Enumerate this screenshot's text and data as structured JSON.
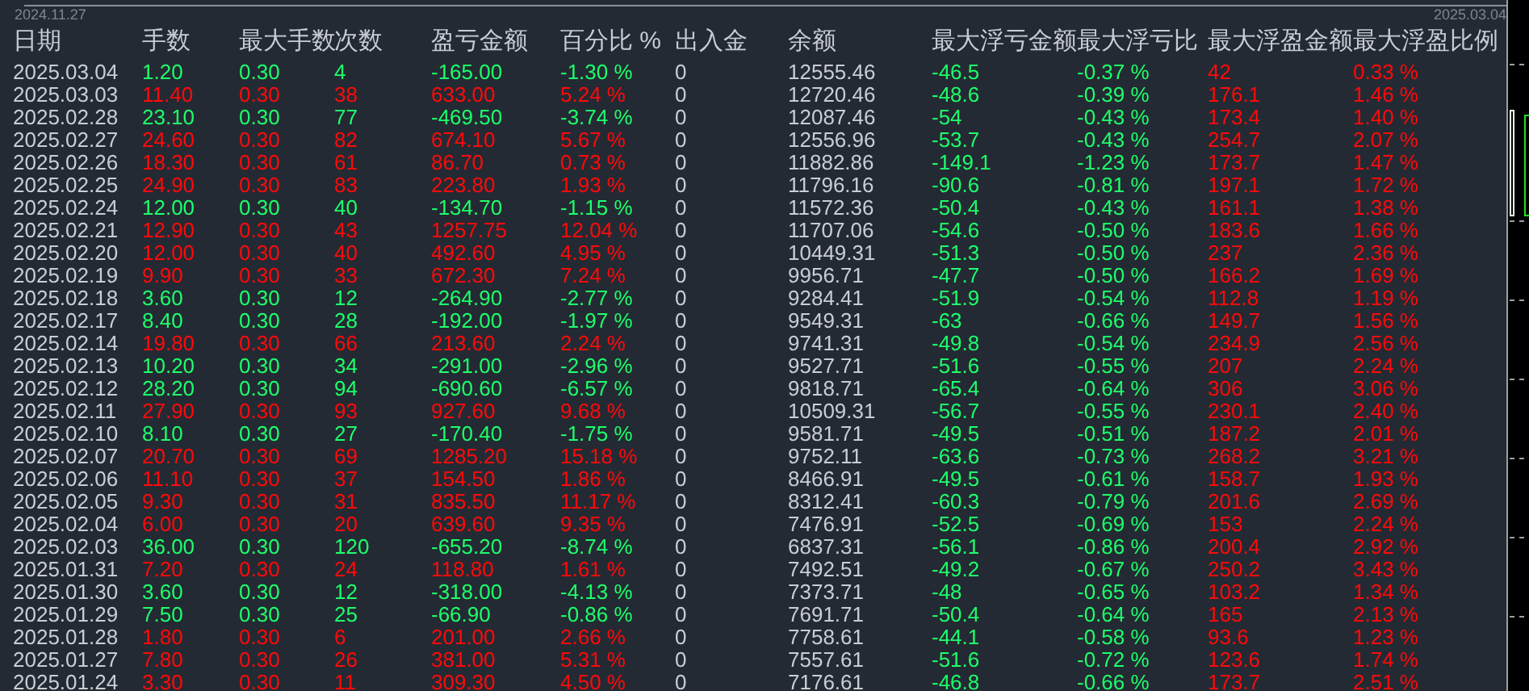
{
  "chart": {
    "start_date": "2024.11.27",
    "end_date": "2025.03.04"
  },
  "table": {
    "columns": [
      "日期",
      "手数",
      "最大手数",
      "次数",
      "盈亏金额",
      "百分比 %",
      "出入金",
      "余额",
      "最大浮亏金额",
      "最大浮亏比",
      "最大浮盈金额",
      "最大浮盈比例"
    ],
    "rows": [
      {
        "kind": "loss",
        "cells": [
          "2025.03.04",
          "1.20",
          "0.30",
          "4",
          "-165.00",
          "-1.30 %",
          "0",
          "12555.46",
          "-46.5",
          "-0.37 %",
          "42",
          "0.33 %"
        ]
      },
      {
        "kind": "profit",
        "cells": [
          "2025.03.03",
          "11.40",
          "0.30",
          "38",
          "633.00",
          "5.24 %",
          "0",
          "12720.46",
          "-48.6",
          "-0.39 %",
          "176.1",
          "1.46 %"
        ]
      },
      {
        "kind": "loss",
        "cells": [
          "2025.02.28",
          "23.10",
          "0.30",
          "77",
          "-469.50",
          "-3.74 %",
          "0",
          "12087.46",
          "-54",
          "-0.43 %",
          "173.4",
          "1.40 %"
        ]
      },
      {
        "kind": "profit",
        "cells": [
          "2025.02.27",
          "24.60",
          "0.30",
          "82",
          "674.10",
          "5.67 %",
          "0",
          "12556.96",
          "-53.7",
          "-0.43 %",
          "254.7",
          "2.07 %"
        ]
      },
      {
        "kind": "profit",
        "cells": [
          "2025.02.26",
          "18.30",
          "0.30",
          "61",
          "86.70",
          "0.73 %",
          "0",
          "11882.86",
          "-149.1",
          "-1.23 %",
          "173.7",
          "1.47 %"
        ]
      },
      {
        "kind": "profit",
        "cells": [
          "2025.02.25",
          "24.90",
          "0.30",
          "83",
          "223.80",
          "1.93 %",
          "0",
          "11796.16",
          "-90.6",
          "-0.81 %",
          "197.1",
          "1.72 %"
        ]
      },
      {
        "kind": "loss",
        "cells": [
          "2025.02.24",
          "12.00",
          "0.30",
          "40",
          "-134.70",
          "-1.15 %",
          "0",
          "11572.36",
          "-50.4",
          "-0.43 %",
          "161.1",
          "1.38 %"
        ]
      },
      {
        "kind": "profit",
        "cells": [
          "2025.02.21",
          "12.90",
          "0.30",
          "43",
          "1257.75",
          "12.04 %",
          "0",
          "11707.06",
          "-54.6",
          "-0.50 %",
          "183.6",
          "1.66 %"
        ]
      },
      {
        "kind": "profit",
        "cells": [
          "2025.02.20",
          "12.00",
          "0.30",
          "40",
          "492.60",
          "4.95 %",
          "0",
          "10449.31",
          "-51.3",
          "-0.50 %",
          "237",
          "2.36 %"
        ]
      },
      {
        "kind": "profit",
        "cells": [
          "2025.02.19",
          "9.90",
          "0.30",
          "33",
          "672.30",
          "7.24 %",
          "0",
          "9956.71",
          "-47.7",
          "-0.50 %",
          "166.2",
          "1.69 %"
        ]
      },
      {
        "kind": "loss",
        "cells": [
          "2025.02.18",
          "3.60",
          "0.30",
          "12",
          "-264.90",
          "-2.77 %",
          "0",
          "9284.41",
          "-51.9",
          "-0.54 %",
          "112.8",
          "1.19 %"
        ]
      },
      {
        "kind": "loss",
        "cells": [
          "2025.02.17",
          "8.40",
          "0.30",
          "28",
          "-192.00",
          "-1.97 %",
          "0",
          "9549.31",
          "-63",
          "-0.66 %",
          "149.7",
          "1.56 %"
        ]
      },
      {
        "kind": "profit",
        "cells": [
          "2025.02.14",
          "19.80",
          "0.30",
          "66",
          "213.60",
          "2.24 %",
          "0",
          "9741.31",
          "-49.8",
          "-0.54 %",
          "234.9",
          "2.56 %"
        ]
      },
      {
        "kind": "loss",
        "cells": [
          "2025.02.13",
          "10.20",
          "0.30",
          "34",
          "-291.00",
          "-2.96 %",
          "0",
          "9527.71",
          "-51.6",
          "-0.55 %",
          "207",
          "2.24 %"
        ]
      },
      {
        "kind": "loss",
        "cells": [
          "2025.02.12",
          "28.20",
          "0.30",
          "94",
          "-690.60",
          "-6.57 %",
          "0",
          "9818.71",
          "-65.4",
          "-0.64 %",
          "306",
          "3.06 %"
        ]
      },
      {
        "kind": "profit",
        "cells": [
          "2025.02.11",
          "27.90",
          "0.30",
          "93",
          "927.60",
          "9.68 %",
          "0",
          "10509.31",
          "-56.7",
          "-0.55 %",
          "230.1",
          "2.40 %"
        ]
      },
      {
        "kind": "loss",
        "cells": [
          "2025.02.10",
          "8.10",
          "0.30",
          "27",
          "-170.40",
          "-1.75 %",
          "0",
          "9581.71",
          "-49.5",
          "-0.51 %",
          "187.2",
          "2.01 %"
        ]
      },
      {
        "kind": "profit",
        "cells": [
          "2025.02.07",
          "20.70",
          "0.30",
          "69",
          "1285.20",
          "15.18 %",
          "0",
          "9752.11",
          "-63.6",
          "-0.73 %",
          "268.2",
          "3.21 %"
        ]
      },
      {
        "kind": "profit",
        "cells": [
          "2025.02.06",
          "11.10",
          "0.30",
          "37",
          "154.50",
          "1.86 %",
          "0",
          "8466.91",
          "-49.5",
          "-0.61 %",
          "158.7",
          "1.93 %"
        ]
      },
      {
        "kind": "profit",
        "cells": [
          "2025.02.05",
          "9.30",
          "0.30",
          "31",
          "835.50",
          "11.17 %",
          "0",
          "8312.41",
          "-60.3",
          "-0.79 %",
          "201.6",
          "2.69 %"
        ]
      },
      {
        "kind": "profit",
        "cells": [
          "2025.02.04",
          "6.00",
          "0.30",
          "20",
          "639.60",
          "9.35 %",
          "0",
          "7476.91",
          "-52.5",
          "-0.69 %",
          "153",
          "2.24 %"
        ]
      },
      {
        "kind": "loss",
        "cells": [
          "2025.02.03",
          "36.00",
          "0.30",
          "120",
          "-655.20",
          "-8.74 %",
          "0",
          "6837.31",
          "-56.1",
          "-0.86 %",
          "200.4",
          "2.92 %"
        ]
      },
      {
        "kind": "profit",
        "cells": [
          "2025.01.31",
          "7.20",
          "0.30",
          "24",
          "118.80",
          "1.61 %",
          "0",
          "7492.51",
          "-49.2",
          "-0.67 %",
          "250.2",
          "3.43 %"
        ]
      },
      {
        "kind": "loss",
        "cells": [
          "2025.01.30",
          "3.60",
          "0.30",
          "12",
          "-318.00",
          "-4.13 %",
          "0",
          "7373.71",
          "-48",
          "-0.65 %",
          "103.2",
          "1.34 %"
        ]
      },
      {
        "kind": "loss",
        "cells": [
          "2025.01.29",
          "7.50",
          "0.30",
          "25",
          "-66.90",
          "-0.86 %",
          "0",
          "7691.71",
          "-50.4",
          "-0.64 %",
          "165",
          "2.13 %"
        ]
      },
      {
        "kind": "profit",
        "cells": [
          "2025.01.28",
          "1.80",
          "0.30",
          "6",
          "201.00",
          "2.66 %",
          "0",
          "7758.61",
          "-44.1",
          "-0.58 %",
          "93.6",
          "1.23 %"
        ]
      },
      {
        "kind": "profit",
        "cells": [
          "2025.01.27",
          "7.80",
          "0.30",
          "26",
          "381.00",
          "5.31 %",
          "0",
          "7557.61",
          "-51.6",
          "-0.72 %",
          "123.6",
          "1.74 %"
        ]
      },
      {
        "kind": "profit",
        "cells": [
          "2025.01.24",
          "3.30",
          "0.30",
          "11",
          "309.30",
          "4.50 %",
          "0",
          "7176.61",
          "-46.8",
          "-0.66 %",
          "173.7",
          "2.51 %"
        ]
      }
    ]
  }
}
